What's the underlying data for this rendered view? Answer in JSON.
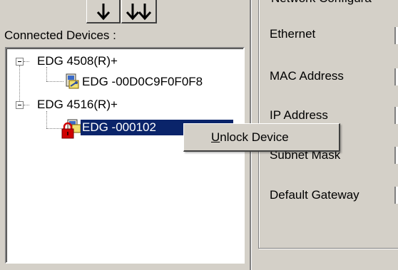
{
  "toolbar": {
    "down_button_icon": "arrow-down-icon",
    "double_down_button_icon": "double-arrow-down-icon"
  },
  "devices": {
    "section_label": "Connected Devices :",
    "groups": [
      {
        "label": "EDG 4508(R)+",
        "children": [
          {
            "label": "EDG -00D0C9F0F0F8",
            "icon": "device-icon"
          }
        ]
      },
      {
        "label": "EDG 4516(R)+",
        "children": [
          {
            "label": "EDG -000102",
            "icon": "locked-device-icon",
            "selected": true
          }
        ]
      }
    ]
  },
  "network": {
    "group_title_fragment": "Network Configura",
    "fields": {
      "ethernet": "Ethernet",
      "mac_address": "MAC Address",
      "ip_address": "IP Address",
      "subnet_mask": "Subnet Mask",
      "default_gateway": "Default Gateway"
    }
  },
  "context_menu": {
    "items": [
      {
        "prefix": "",
        "mnemonic": "U",
        "rest": "nlock Device"
      }
    ]
  },
  "colors": {
    "window_bg": "#d4d0c8",
    "selection_bg": "#0a246a",
    "lock_red": "#d00000"
  }
}
